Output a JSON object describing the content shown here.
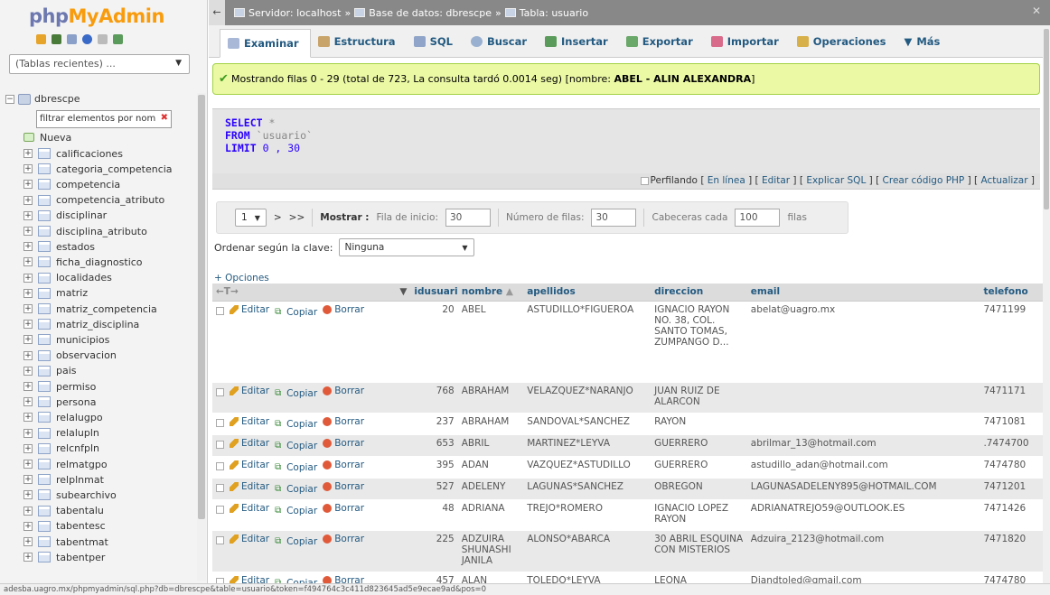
{
  "nav": {
    "logo_a": "php",
    "logo_b": "MyAdmin",
    "recent": "(Tablas recientes) ...",
    "db": "dbrescpe",
    "filter_placeholder": "filtrar elementos por nom",
    "new": "Nueva",
    "tables": [
      "calificaciones",
      "categoria_competencia",
      "competencia",
      "competencia_atributo",
      "disciplinar",
      "disciplina_atributo",
      "estados",
      "ficha_diagnostico",
      "localidades",
      "matriz",
      "matriz_competencia",
      "matriz_disciplina",
      "municipios",
      "observacion",
      "pais",
      "permiso",
      "persona",
      "relalugpo",
      "relalupln",
      "relcnfpln",
      "relmatgpo",
      "relplnmat",
      "subearchivo",
      "tabentalu",
      "tabentesc",
      "tabentmat",
      "tabentper"
    ]
  },
  "breadcrumb": {
    "server": "Servidor: localhost",
    "db": "Base de datos: dbrescpe",
    "table": "Tabla: usuario"
  },
  "tabs": [
    "Examinar",
    "Estructura",
    "SQL",
    "Buscar",
    "Insertar",
    "Exportar",
    "Importar",
    "Operaciones",
    "Más"
  ],
  "success": {
    "text": "Mostrando filas 0 - 29 (total de 723, La consulta tardó 0.0014 seg) [nombre: ",
    "bold": "ABEL - ALIN ALEXANDRA",
    "end": "]"
  },
  "sql": {
    "select": "SELECT",
    "star": "*",
    "from": "FROM",
    "table": "`usuario`",
    "limit": "LIMIT",
    "limit_val": "0 , 30"
  },
  "sqllinks": {
    "profile": "Perfilando",
    "l1": "En línea",
    "l2": "Editar",
    "l3": "Explicar SQL",
    "l4": "Crear código PHP",
    "l5": "Actualizar"
  },
  "navbar": {
    "page": "1",
    "next": ">",
    "last": ">>",
    "show_label": "Mostrar :",
    "start_label": "Fila de inicio:",
    "start_val": "30",
    "rows_label": "Número de filas:",
    "rows_val": "30",
    "headers_label": "Cabeceras cada",
    "headers_val": "100",
    "rows_suffix": "filas"
  },
  "sort": {
    "label": "Ordenar según la clave:",
    "value": "Ninguna"
  },
  "options": "+ Opciones",
  "table": {
    "columns": [
      "idusuario",
      "nombre",
      "apellidos",
      "direccion",
      "email",
      "telefono"
    ],
    "actions": {
      "edit": "Editar",
      "copy": "Copiar",
      "delete": "Borrar"
    },
    "rows": [
      {
        "id": "20",
        "nombre": "ABEL",
        "apellidos": "ASTUDILLO*FIGUEROA",
        "direccion": "IGNACIO RAYON NO. 38, COL. SANTO TOMAS, ZUMPANGO D...",
        "email": "abelat@uagro.mx",
        "telefono": "7471199"
      },
      {
        "id": "768",
        "nombre": "ABRAHAM",
        "apellidos": "VELAZQUEZ*NARANJO",
        "direccion": "JUAN RUIZ DE ALARCON",
        "email": "",
        "telefono": "7471171"
      },
      {
        "id": "237",
        "nombre": "ABRAHAM",
        "apellidos": "SANDOVAL*SANCHEZ",
        "direccion": "RAYON",
        "email": "",
        "telefono": "7471081"
      },
      {
        "id": "653",
        "nombre": "ABRIL",
        "apellidos": "MARTINEZ*LEYVA",
        "direccion": "GUERRERO",
        "email": "abrilmar_13@hotmail.com",
        "telefono": ".7474700"
      },
      {
        "id": "395",
        "nombre": "ADAN",
        "apellidos": "VAZQUEZ*ASTUDILLO",
        "direccion": "GUERRERO",
        "email": "astudillo_adan@hotmail.com",
        "telefono": "7474780"
      },
      {
        "id": "527",
        "nombre": "ADELENY",
        "apellidos": "LAGUNAS*SANCHEZ",
        "direccion": "OBREGON",
        "email": "LAGUNASADELENY895@HOTMAIL.COM",
        "telefono": "7471201"
      },
      {
        "id": "48",
        "nombre": "ADRIANA",
        "apellidos": "TREJO*ROMERO",
        "direccion": "IGNACIO LOPEZ RAYON",
        "email": "ADRIANATREJO59@OUTLOOK.ES",
        "telefono": "7471426"
      },
      {
        "id": "225",
        "nombre": "ADZUIRA SHUNASHI JANILA",
        "apellidos": "ALONSO*ABARCA",
        "direccion": "30 ABRIL ESQUINA CON MISTERIOS",
        "email": "Adzuira_2123@hotmail.com",
        "telefono": "7471820"
      },
      {
        "id": "457",
        "nombre": "ALAN",
        "apellidos": "TOLEDO*LEYVA",
        "direccion": "LEONA",
        "email": "Diandtoled@gmail.com",
        "telefono": "7474780"
      }
    ]
  },
  "status_url": "adesba.uagro.mx/phpmyadmin/sql.php?db=dbrescpe&table=usuario&token=f494764c3c411d823645ad5e9ecae9ad&pos=0"
}
